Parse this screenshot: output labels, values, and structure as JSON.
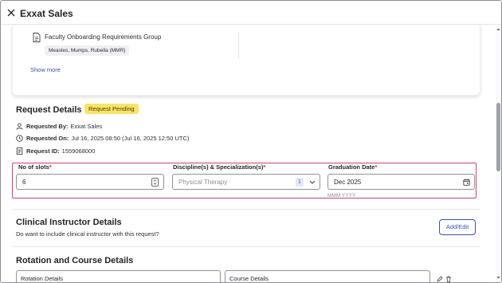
{
  "header": {
    "title": "Exxat Sales",
    "close_icon": "close-icon"
  },
  "requirements": {
    "group_name": "Faculty Onboarding Requirements Group",
    "chip": "Measles, Mumps, Rubella (MMR)",
    "show_more": "Show more"
  },
  "request_details": {
    "title": "Request Details",
    "status": "Request Pending",
    "requested_by_label": "Requested By:",
    "requested_by_value": "Exxat Sales",
    "requested_on_label": "Requested On:",
    "requested_on_value": "Jul 16, 2025 08:50 (Jul 16, 2025 12:50 UTC)",
    "request_id_label": "Request ID:",
    "request_id_value": "1559068000"
  },
  "fields": {
    "slots_label": "No of slots",
    "slots_value": "6",
    "discipline_label": "Discipline(s) & Specialization(s)",
    "discipline_placeholder": "Physical Therapy",
    "discipline_count": "1",
    "graduation_label": "Graduation Date",
    "graduation_value": "Dec 2025",
    "graduation_hint": "MMM YYYY",
    "required_mark": "*"
  },
  "clinical_instructor": {
    "title": "Clinical Instructor Details",
    "question": "Do want to include clinical instructor with this request?",
    "add_edit": "Add/Edit"
  },
  "rotation": {
    "title": "Rotation and Course Details",
    "rotation_details": "Rotation Details",
    "course_details": "Course Details"
  },
  "colors": {
    "accent": "#3a52b4",
    "status_badge": "#fbe36a",
    "highlight_border": "#d4406b",
    "required": "#d4283c"
  }
}
